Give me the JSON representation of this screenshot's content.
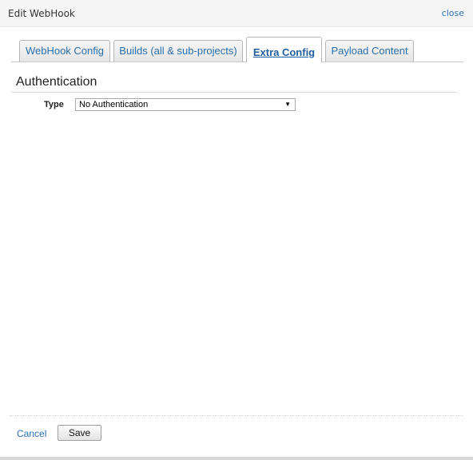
{
  "dialog": {
    "title": "Edit WebHook",
    "close_label": "close"
  },
  "tabs": [
    {
      "label": "WebHook Config",
      "active": false
    },
    {
      "label": "Builds (all & sub-projects)",
      "active": false
    },
    {
      "label": "Extra Config",
      "active": true
    },
    {
      "label": "Payload Content",
      "active": false
    }
  ],
  "authentication": {
    "heading": "Authentication",
    "type_label": "Type",
    "type_value": "No Authentication"
  },
  "footer": {
    "cancel_label": "Cancel",
    "save_label": "Save"
  },
  "colors": {
    "link": "#2a72b5",
    "title_bar": "#f5f5f5"
  }
}
